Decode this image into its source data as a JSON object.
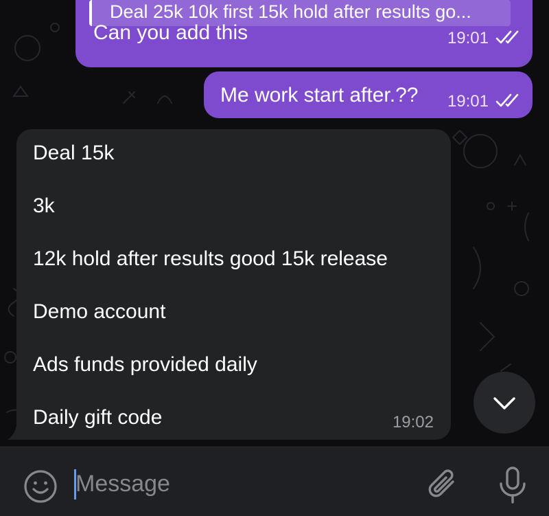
{
  "messages": [
    {
      "direction": "outgoing",
      "reply_preview": "Deal 25k  10k first  15k hold after results go...",
      "text": "Can you add this",
      "time": "19:01",
      "status_icon": "double-check-icon"
    },
    {
      "direction": "outgoing",
      "text": "Me work start after.??",
      "time": "19:01",
      "status_icon": "double-check-icon"
    },
    {
      "direction": "incoming",
      "lines": [
        "Deal 15k",
        "3k",
        "12k hold after results good 15k release",
        "Demo account",
        "Ads funds provided daily",
        "Daily gift code"
      ],
      "time": "19:02"
    }
  ],
  "composer": {
    "placeholder": "Message",
    "left_icon": "emoji-icon",
    "right_icons": [
      "paperclip-icon",
      "microphone-icon"
    ]
  },
  "scroll_button_icon": "chevron-down-icon",
  "colors": {
    "outgoing_bubble": "#7e4bcf",
    "incoming_bubble": "#222325",
    "background": "#0d0d10",
    "input_bar": "#1f2024",
    "caret": "#6a9bf2"
  }
}
